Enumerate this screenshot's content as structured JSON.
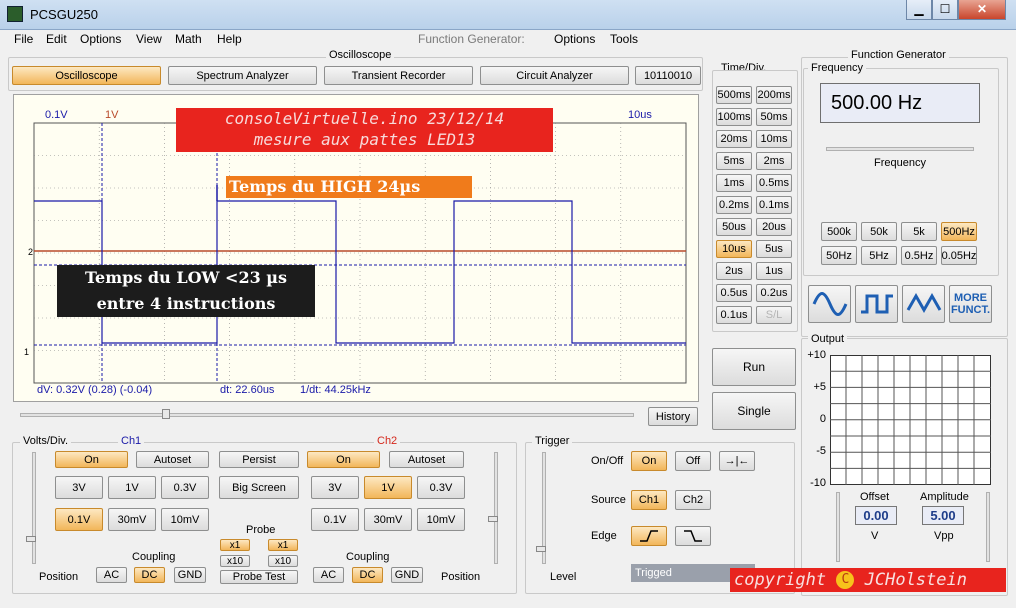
{
  "window": {
    "title": "PCSGU250",
    "min": "▁",
    "max": "☐",
    "close": "✕"
  },
  "menu": {
    "items": [
      "File",
      "Edit",
      "Options",
      "View",
      "Math",
      "Help"
    ],
    "fg_label": "Function Generator:",
    "fg_items": [
      "Options",
      "Tools"
    ]
  },
  "osc_group": {
    "label": "Oscilloscope",
    "tabs": [
      {
        "label": "Oscilloscope",
        "active": true
      },
      {
        "label": "Spectrum Analyzer",
        "active": false
      },
      {
        "label": "Transient Recorder",
        "active": false
      },
      {
        "label": "Circuit Analyzer",
        "active": false
      },
      {
        "label": "10110010",
        "active": false
      }
    ]
  },
  "scope": {
    "top_labels": {
      "ch1_div": "0.1V",
      "ch2_div": "1V",
      "time_div": "10us"
    },
    "markers": {
      "ch1": "1",
      "ch2": "2"
    },
    "annotations": {
      "title_line1": "consoleVirtuelle.ino 23/12/14",
      "title_line2": "mesure aux pattes LED13",
      "high": "Temps du HIGH 24µs",
      "low_line1": "Temps du LOW <23 µs",
      "low_line2": "entre 4 instructions"
    },
    "readouts": {
      "dv": "dV: 0.32V  (0.28) (-0.04)",
      "dt": "dt: 22.60us",
      "inv_dt": "1/dt: 44.25kHz"
    },
    "colors": {
      "ch1": "#1a1aa8",
      "ch2": "#b84a2a",
      "grid": "#666666"
    }
  },
  "history_label": "History",
  "timediv": {
    "label": "Time/Div.",
    "buttons": [
      [
        "500ms",
        "200ms"
      ],
      [
        "100ms",
        "50ms"
      ],
      [
        "20ms",
        "10ms"
      ],
      [
        "5ms",
        "2ms"
      ],
      [
        "1ms",
        "0.5ms"
      ],
      [
        "0.2ms",
        "0.1ms"
      ],
      [
        "50us",
        "20us"
      ],
      [
        "10us",
        "5us"
      ],
      [
        "2us",
        "1us"
      ],
      [
        "0.5us",
        "0.2us"
      ],
      [
        "0.1us",
        "S/L"
      ]
    ],
    "active": "10us",
    "disabled": "S/L"
  },
  "run_label": "Run",
  "single_label": "Single",
  "volts": {
    "label": "Volts/Div.",
    "ch1_label": "Ch1",
    "ch2_label": "Ch2",
    "on": "On",
    "autoset": "Autoset",
    "persist": "Persist",
    "big_screen": "Big Screen",
    "ch1_row1": [
      "3V",
      "1V",
      "0.3V"
    ],
    "ch1_row2": [
      "0.1V",
      "30mV",
      "10mV"
    ],
    "ch2_row1": [
      "3V",
      "1V",
      "0.3V"
    ],
    "ch2_row2": [
      "0.1V",
      "30mV",
      "10mV"
    ],
    "ch1_active": "0.1V",
    "ch2_active": "1V",
    "probe_label": "Probe",
    "x1": "x1",
    "x10": "x10",
    "probe_test": "Probe Test",
    "coupling_label": "Coupling",
    "coupling": [
      "AC",
      "DC",
      "GND"
    ],
    "coupling_active": "DC",
    "position_label": "Position"
  },
  "trigger": {
    "label": "Trigger",
    "onoff_label": "On/Off",
    "on": "On",
    "off": "Off",
    "source_label": "Source",
    "ch1": "Ch1",
    "ch2": "Ch2",
    "edge_label": "Edge",
    "level_label": "Level",
    "status": "Trigged"
  },
  "fg": {
    "label": "Function Generator",
    "freq_label": "Frequency",
    "freq_value": "500.00 Hz",
    "freq_slider_label": "Frequency",
    "range_row1": [
      "500k",
      "50k",
      "5k",
      "500Hz"
    ],
    "range_row2": [
      "50Hz",
      "5Hz",
      "0.5Hz",
      "0.05Hz"
    ],
    "range_active": "500Hz",
    "more": "MORE FUNCT.",
    "output_label": "Output",
    "y_ticks": [
      "+10",
      "+5",
      "0",
      "-5",
      "-10"
    ],
    "offset_label": "Offset",
    "offset_value": "0.00",
    "offset_unit": "V",
    "amplitude_label": "Amplitude",
    "amplitude_value": "5.00",
    "amplitude_unit": "Vpp"
  },
  "copyright": {
    "text": "copyright",
    "symbol": "C",
    "author": "JCHolstein"
  }
}
